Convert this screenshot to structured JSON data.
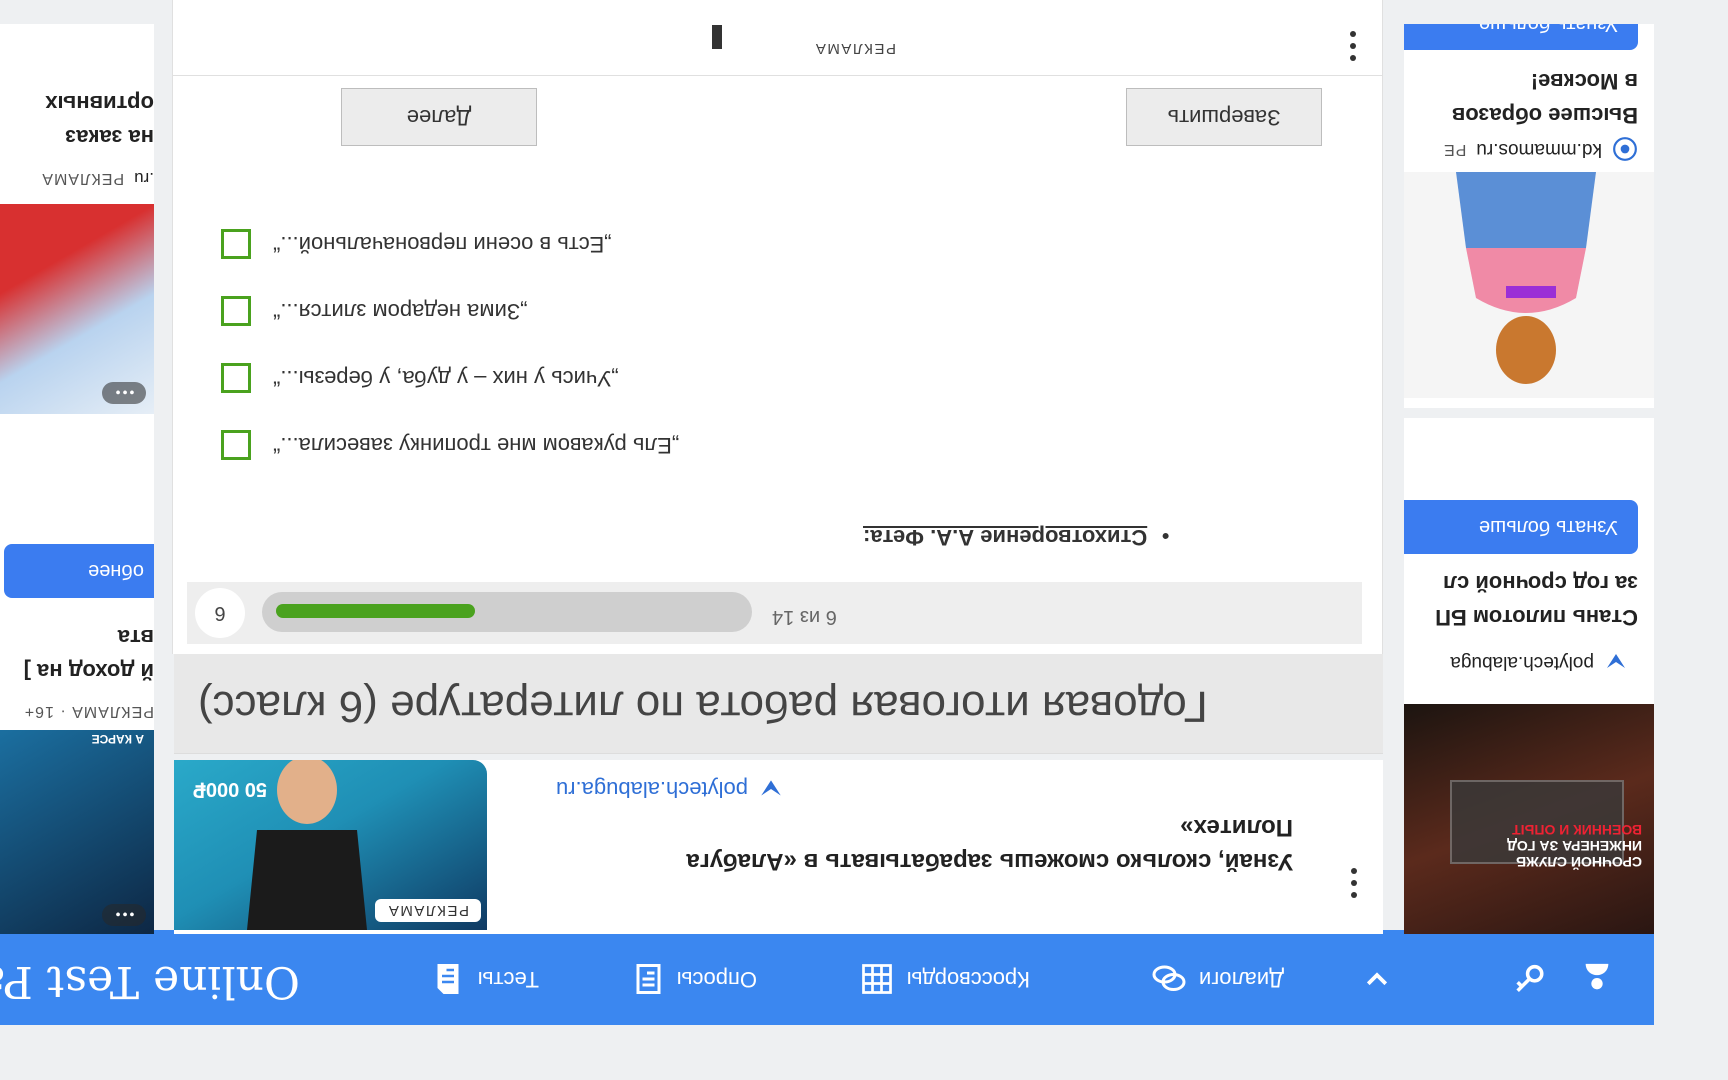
{
  "header": {
    "logo": "Online Test Pad",
    "nav": [
      {
        "label": "Тесты",
        "icon": "document-icon"
      },
      {
        "label": "Опросы",
        "icon": "form-icon"
      },
      {
        "label": "Кроссворды",
        "icon": "crossword-icon"
      },
      {
        "label": "Диалоги",
        "icon": "chat-icon"
      }
    ],
    "icons": [
      "chevron-down-icon",
      "key-icon",
      "user-icon"
    ]
  },
  "left_ads": {
    "ad1": {
      "title_lines": [
        "Стань пилотом БП",
        "за год срочной сл"
      ],
      "source": "polytech.alabuga",
      "button": "Узнать больше",
      "image_text": [
        "СРОЧНОЙ СЛУЖБ",
        "ИНЖЕНЕРА ЗА ГОД",
        "ВОЕННИК И ОПЫТ"
      ]
    },
    "ad2": {
      "title_lines": [
        "Высшее образов",
        "в Москве!"
      ],
      "source": "kd.mmamos.ru",
      "source_tag": "РЕ",
      "button": "Узнать больше"
    }
  },
  "right_ads": {
    "ad1": {
      "tag": "РЕКЛАМА",
      "title_lines": [
        "й доход на ]",
        "вта"
      ],
      "source_tag": "РЕКЛАМА · 16+",
      "button": "обнее",
      "image_text": "А КАРСЕ"
    },
    "ad2": {
      "title_lines": [
        "на заказ",
        "ортивных"
      ],
      "source": ".ru",
      "source_tag": "РЕКЛАМА"
    }
  },
  "banner_ad": {
    "source": "polytech.alabuga.ru",
    "title_lines": [
      "Узнай, сколько сможешь зарабатывать в «Алабуга",
      "Политех»"
    ],
    "tag": "РЕКЛАМА",
    "image_text": "50 000₽"
  },
  "test": {
    "title": "Годовая итоговая работа по литературе (6 класс)",
    "progress": {
      "current": 6,
      "total": 14,
      "text": "6 из 14",
      "fraction": 0.43,
      "number": "6"
    },
    "question": "Стихотворение А.А. Фета:",
    "answers": [
      "„Ель рукавом мне тропинку завесила...“",
      "„Учись у них – у дуба, у березы...“",
      "„Зима недаром злится...“",
      "„Есть в осени первоначальной...“"
    ],
    "buttons": {
      "next": "Далее",
      "finish": "Завершить"
    }
  },
  "bottom_ad": {
    "tag": "РЕКЛАМА"
  },
  "colors": {
    "accent": "#3b87f0",
    "check": "#4aa21e"
  }
}
